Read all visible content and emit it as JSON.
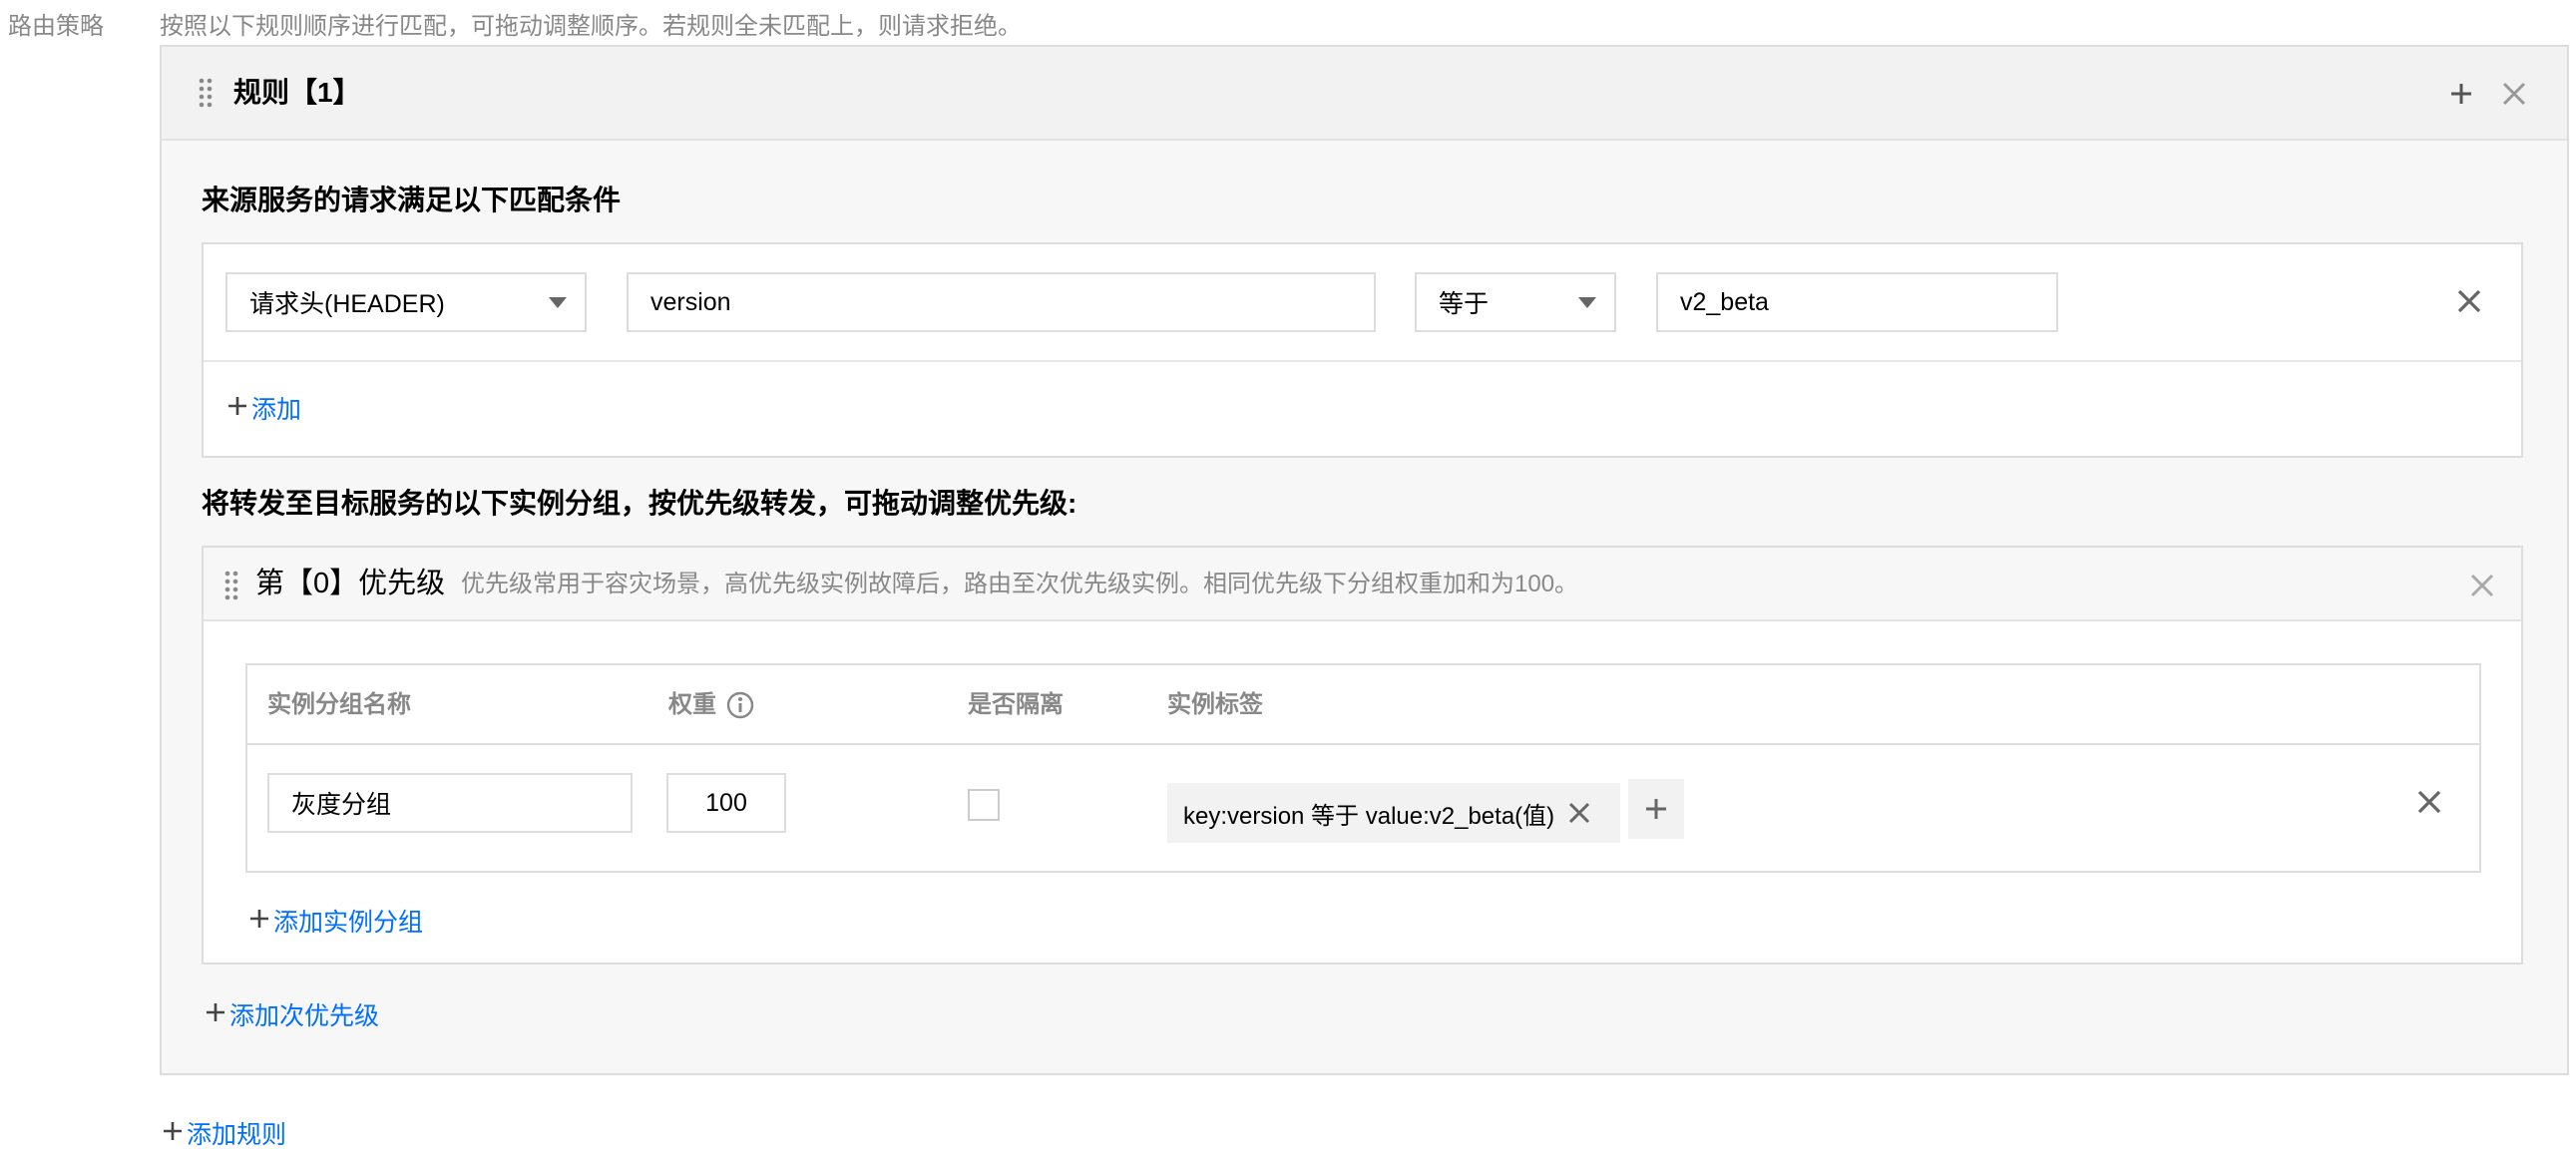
{
  "strategy": {
    "label": "路由策略",
    "hint": "按照以下规则顺序进行匹配，可拖动调整顺序。若规则全未匹配上，则请求拒绝。"
  },
  "rule": {
    "title": "规则【1】",
    "source_heading": "来源服务的请求满足以下匹配条件",
    "condition": {
      "type_value": "请求头(HEADER)",
      "key_value": "version",
      "operator_value": "等于",
      "value_value": "v2_beta"
    },
    "add_condition_label": "添加",
    "target_heading": "将转发至目标服务的以下实例分组，按优先级转发，可拖动调整优先级:",
    "priority": {
      "title": "第【0】优先级",
      "hint": "优先级常用于容灾场景，高优先级实例故障后，路由至次优先级实例。相同优先级下分组权重加和为100。",
      "columns": {
        "name": "实例分组名称",
        "weight": "权重",
        "isolate": "是否隔离",
        "tags": "实例标签"
      },
      "row": {
        "name": "灰度分组",
        "weight": "100",
        "isolated": false,
        "tag": "key:version 等于 value:v2_beta(值)"
      },
      "add_group_label": "添加实例分组"
    },
    "add_priority_label": "添加次优先级"
  },
  "add_rule_label": "添加规则",
  "icons": {
    "drag": "drag-handle-icon",
    "plus": "plus-icon",
    "close": "close-icon",
    "info": "info-icon",
    "caret": "caret-down-icon"
  },
  "colors": {
    "link": "#006eff",
    "border": "#dddddd",
    "muted": "#888888",
    "header_bg": "#f2f2f2",
    "panel_bg": "#f7f7f7"
  }
}
